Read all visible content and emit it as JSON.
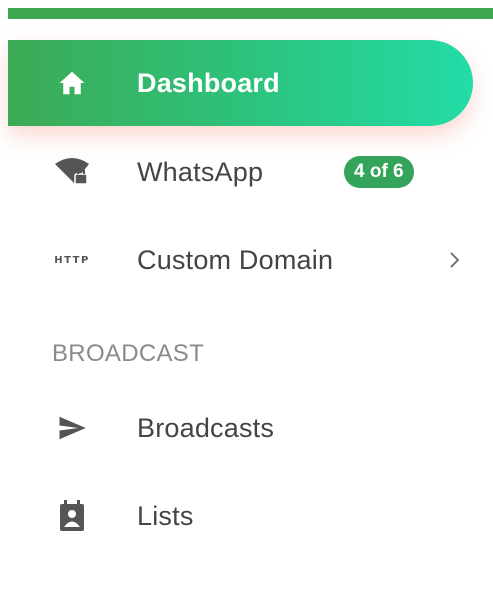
{
  "colors": {
    "top_bar": "#3da84f",
    "active_gradient_start": "#3daa55",
    "active_gradient_end": "#23dca7",
    "badge": "#33a45a",
    "text": "#444444",
    "section_header": "#8a8a8a"
  },
  "sidebar": {
    "items": [
      {
        "label": "Dashboard",
        "icon": "home-icon",
        "active": true
      },
      {
        "label": "WhatsApp",
        "icon": "wifi-lock-icon",
        "badge": "4 of 6"
      },
      {
        "label": "Custom Domain",
        "icon": "http-icon",
        "icon_text": "HTTP",
        "expandable": true
      }
    ],
    "sections": [
      {
        "header": "BROADCAST",
        "items": [
          {
            "label": "Broadcasts",
            "icon": "send-icon"
          },
          {
            "label": "Lists",
            "icon": "contact-list-icon"
          }
        ]
      }
    ]
  }
}
